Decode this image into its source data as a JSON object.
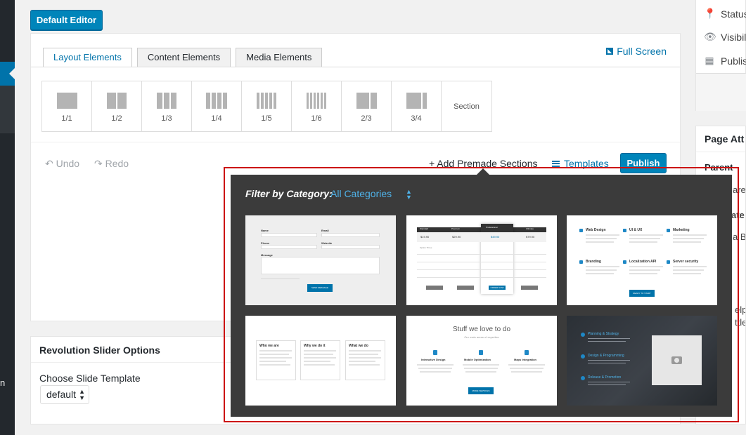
{
  "sidebar": {
    "truncated_label": "n"
  },
  "default_editor_label": "Default Editor",
  "editor": {
    "tabs": [
      {
        "label": "Layout Elements",
        "active": true
      },
      {
        "label": "Content Elements",
        "active": false
      },
      {
        "label": "Media Elements",
        "active": false
      }
    ],
    "fullscreen_label": "Full Screen",
    "layouts": [
      {
        "label": "1/1"
      },
      {
        "label": "1/2"
      },
      {
        "label": "1/3"
      },
      {
        "label": "1/4"
      },
      {
        "label": "1/5"
      },
      {
        "label": "1/6"
      },
      {
        "label": "2/3"
      },
      {
        "label": "3/4"
      },
      {
        "label": "Section"
      }
    ],
    "undo_label": "Undo",
    "redo_label": "Redo",
    "add_premade_label": "+ Add Premade Sections",
    "templates_label": "Templates",
    "publish_label": "Publish"
  },
  "revolution": {
    "title": "Revolution Slider Options",
    "choose_label": "Choose Slide Template",
    "select_value": "default"
  },
  "right_sidebar": {
    "publish_rows": [
      {
        "icon": "pin-icon",
        "text": "Status"
      },
      {
        "icon": "eye-icon",
        "text": "Visibil"
      },
      {
        "icon": "calendar-icon",
        "text": "Publis"
      }
    ],
    "attributes_title": "Page Att",
    "parent_label": "Parent",
    "fragments": [
      "are",
      "ate",
      "a B",
      "elp",
      "ttle"
    ]
  },
  "premade": {
    "filter_label": "Filter by Category:",
    "filter_value": "All Categories",
    "accent": "#4fb2e8",
    "frame_color": "#cc1111",
    "thumbs": {
      "contact": {
        "fields": [
          "Name",
          "Email",
          "Phone",
          "Website",
          "Message"
        ],
        "button": "SEND MESSAGE"
      },
      "pricing": {
        "columns": [
          "Standard",
          "Premium",
          "Professional",
          "Ultimate"
        ],
        "prices": [
          "$19.90",
          "$29.90",
          "$49.90",
          "$79.90"
        ],
        "row_label": "Option Three",
        "button": "ORDER NOW"
      },
      "services": {
        "items": [
          "Web Design",
          "UI & UX",
          "Marketing",
          "Branding",
          "Localization API",
          "Server security"
        ],
        "button": "READY TO START"
      },
      "about": {
        "items": [
          "Who we are",
          "Why we do it",
          "What we do"
        ]
      },
      "features": {
        "title": "Stuff we love to do",
        "subtitle": "Our main areas of expertise",
        "items": [
          "Interactive Design",
          "Mobile Optimization",
          "Maps Integration"
        ],
        "button": "MORE SERVICES"
      },
      "dark": {
        "items": [
          "Planning & Strategy",
          "Design & Programming",
          "Release & Promotion"
        ]
      }
    }
  }
}
